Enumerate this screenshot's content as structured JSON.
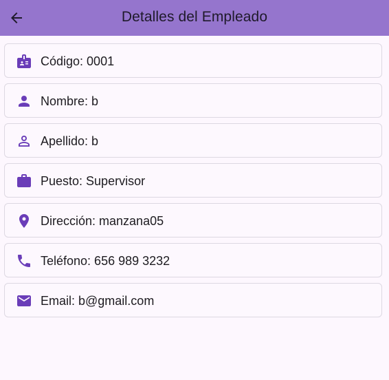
{
  "app_bar": {
    "title": "Detalles del Empleado",
    "back_icon": "arrow-back-icon"
  },
  "colors": {
    "app_bar_bg": "#9575cd",
    "icon_color": "#6a3db8",
    "page_bg": "#fdf7fe"
  },
  "details": [
    {
      "icon": "badge-icon",
      "text": "Código: 0001"
    },
    {
      "icon": "person-icon",
      "text": "Nombre: b"
    },
    {
      "icon": "person-outline-icon",
      "text": "Apellido: b"
    },
    {
      "icon": "work-icon",
      "text": "Puesto: Supervisor"
    },
    {
      "icon": "location-pin-icon",
      "text": "Dirección: manzana05"
    },
    {
      "icon": "phone-icon",
      "text": "Teléfono: 656 989 3232"
    },
    {
      "icon": "email-icon",
      "text": "Email: b@gmail.com"
    }
  ]
}
